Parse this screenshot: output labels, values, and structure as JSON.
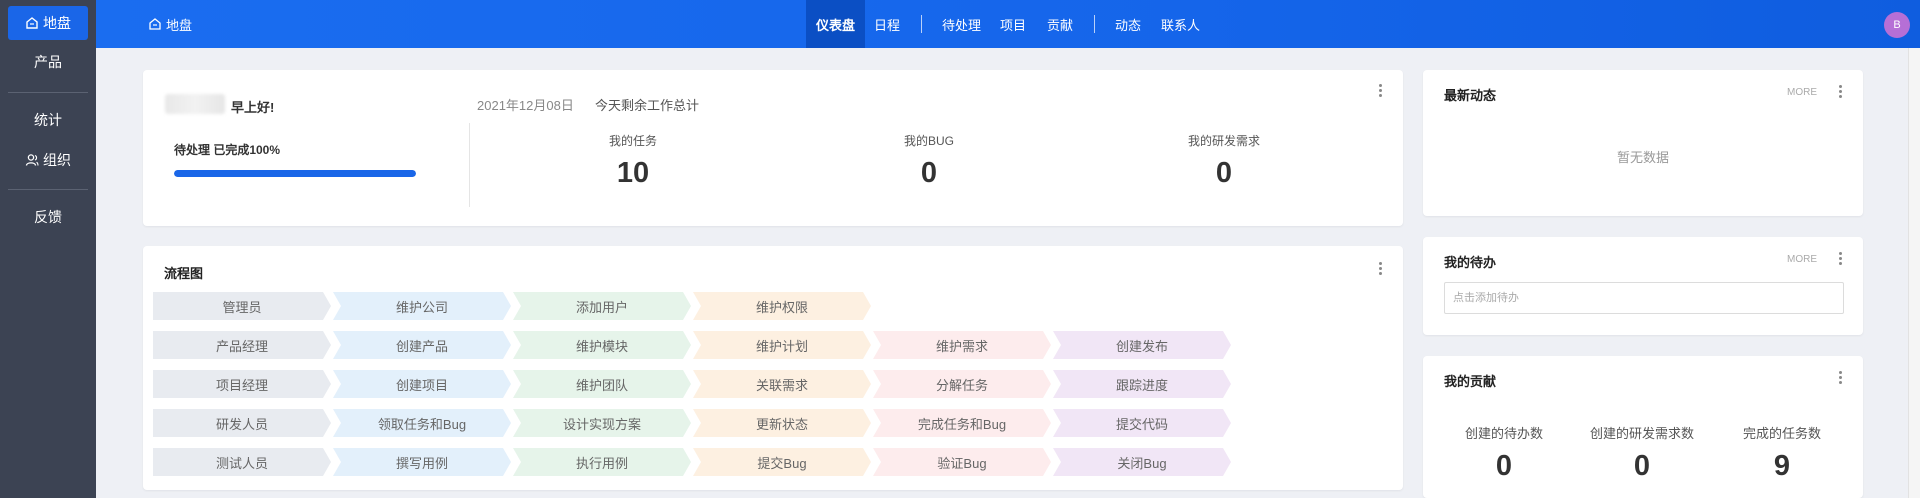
{
  "sidebar": {
    "items": [
      {
        "label": "地盘",
        "icon": "home-icon",
        "active": true
      },
      {
        "label": "产品"
      },
      {
        "label": "统计"
      },
      {
        "label": "组织",
        "icon": "users-icon"
      },
      {
        "label": "反馈"
      }
    ]
  },
  "header": {
    "home_label": "地盘",
    "nav": [
      {
        "label": "仪表盘",
        "active": true
      },
      {
        "label": "日程"
      },
      {
        "label": "待处理"
      },
      {
        "label": "项目"
      },
      {
        "label": "贡献"
      },
      {
        "label": "动态"
      },
      {
        "label": "联系人"
      }
    ],
    "avatar_initial": "B",
    "accent_color": "#1a66e8"
  },
  "welcome": {
    "greeting": "早上好!",
    "pending_text": "待处理 已完成100%",
    "progress_percent": 100,
    "date": "2021年12月08日",
    "date_sub": "今天剩余工作总计",
    "stats": [
      {
        "label": "我的任务",
        "value": "10"
      },
      {
        "label": "我的BUG",
        "value": "0"
      },
      {
        "label": "我的研发需求",
        "value": "0"
      }
    ]
  },
  "flow": {
    "title": "流程图",
    "colors": [
      "#e8ebf0",
      "#e3f0fb",
      "#e6f4ea",
      "#fdf0e1",
      "#fdeced",
      "#f1e6f6"
    ],
    "rows": [
      [
        "管理员",
        "维护公司",
        "添加用户",
        "维护权限"
      ],
      [
        "产品经理",
        "创建产品",
        "维护模块",
        "维护计划",
        "维护需求",
        "创建发布"
      ],
      [
        "项目经理",
        "创建项目",
        "维护团队",
        "关联需求",
        "分解任务",
        "跟踪进度"
      ],
      [
        "研发人员",
        "领取任务和Bug",
        "设计实现方案",
        "更新状态",
        "完成任务和Bug",
        "提交代码"
      ],
      [
        "测试人员",
        "撰写用例",
        "执行用例",
        "提交Bug",
        "验证Bug",
        "关闭Bug"
      ]
    ]
  },
  "latest": {
    "title": "最新动态",
    "more": "MORE",
    "empty": "暂无数据"
  },
  "todo": {
    "title": "我的待办",
    "more": "MORE",
    "placeholder": "点击添加待办"
  },
  "contrib": {
    "title": "我的贡献",
    "items": [
      {
        "label": "创建的待办数",
        "value": "0"
      },
      {
        "label": "创建的研发需求数",
        "value": "0"
      },
      {
        "label": "完成的任务数",
        "value": "9"
      }
    ]
  }
}
